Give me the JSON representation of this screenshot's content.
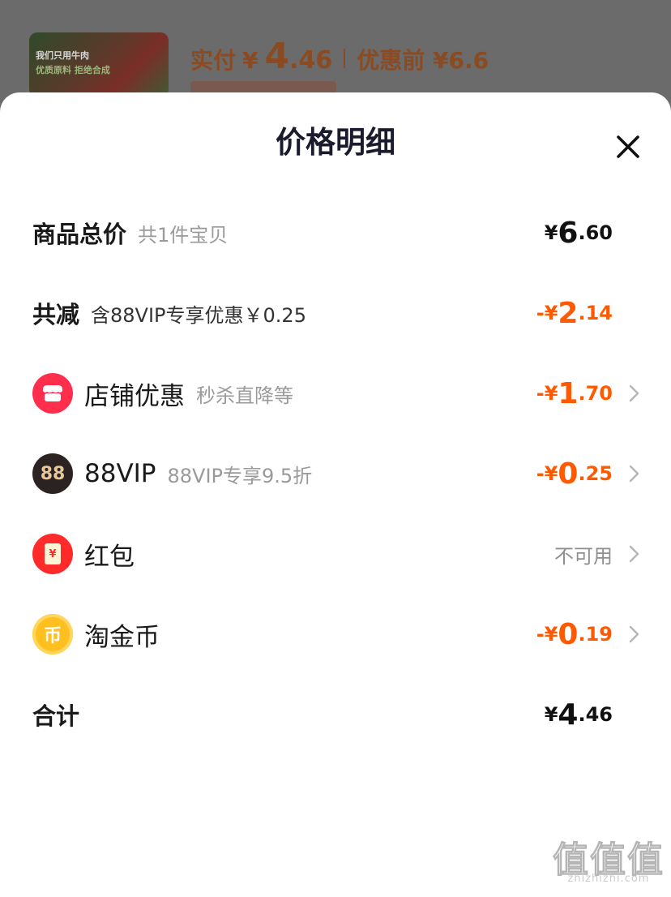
{
  "background": {
    "thumb_line1": "我们只用牛肉",
    "thumb_line2": "优质原料 拒绝合成",
    "paid_label": "实付",
    "paid_currency": "¥",
    "paid_int": "4",
    "paid_dec": ".46",
    "orig_text": "优惠前 ¥6.6"
  },
  "sheet": {
    "title": "价格明细",
    "close_icon": "close-icon"
  },
  "rows": {
    "total": {
      "label": "商品总价",
      "sub": "共1件宝贝",
      "currency": "¥",
      "int": "6",
      "dec": ".60"
    },
    "reduce": {
      "label": "共减",
      "sub": "含88VIP专享优惠￥0.25",
      "currency": "-¥",
      "int": "2",
      "dec": ".14"
    },
    "shop": {
      "icon": "shop-icon",
      "label": "店铺优惠",
      "sub": "秒杀直降等",
      "currency": "-¥",
      "int": "1",
      "dec": ".70"
    },
    "vip": {
      "icon": "vip88-icon",
      "icon_text": "88",
      "label": "88VIP",
      "sub": "88VIP专享9.5折",
      "currency": "-¥",
      "int": "0",
      "dec": ".25"
    },
    "redpacket": {
      "icon": "red-packet-icon",
      "icon_text": "¥",
      "label": "红包",
      "status": "不可用"
    },
    "coin": {
      "icon": "gold-coin-icon",
      "icon_text": "币",
      "label": "淘金币",
      "currency": "-¥",
      "int": "0",
      "dec": ".19"
    },
    "sum": {
      "label": "合计",
      "currency": "¥",
      "int": "4",
      "dec": ".46"
    }
  },
  "watermark": {
    "glyphs": "值值值",
    "url": "zhizhizhi.com"
  },
  "colors": {
    "accent_orange": "#ff5a00",
    "shop_red": "#ff2e4d",
    "vip_dark": "#2b2322",
    "coin_gold": "#ffbf1f"
  }
}
